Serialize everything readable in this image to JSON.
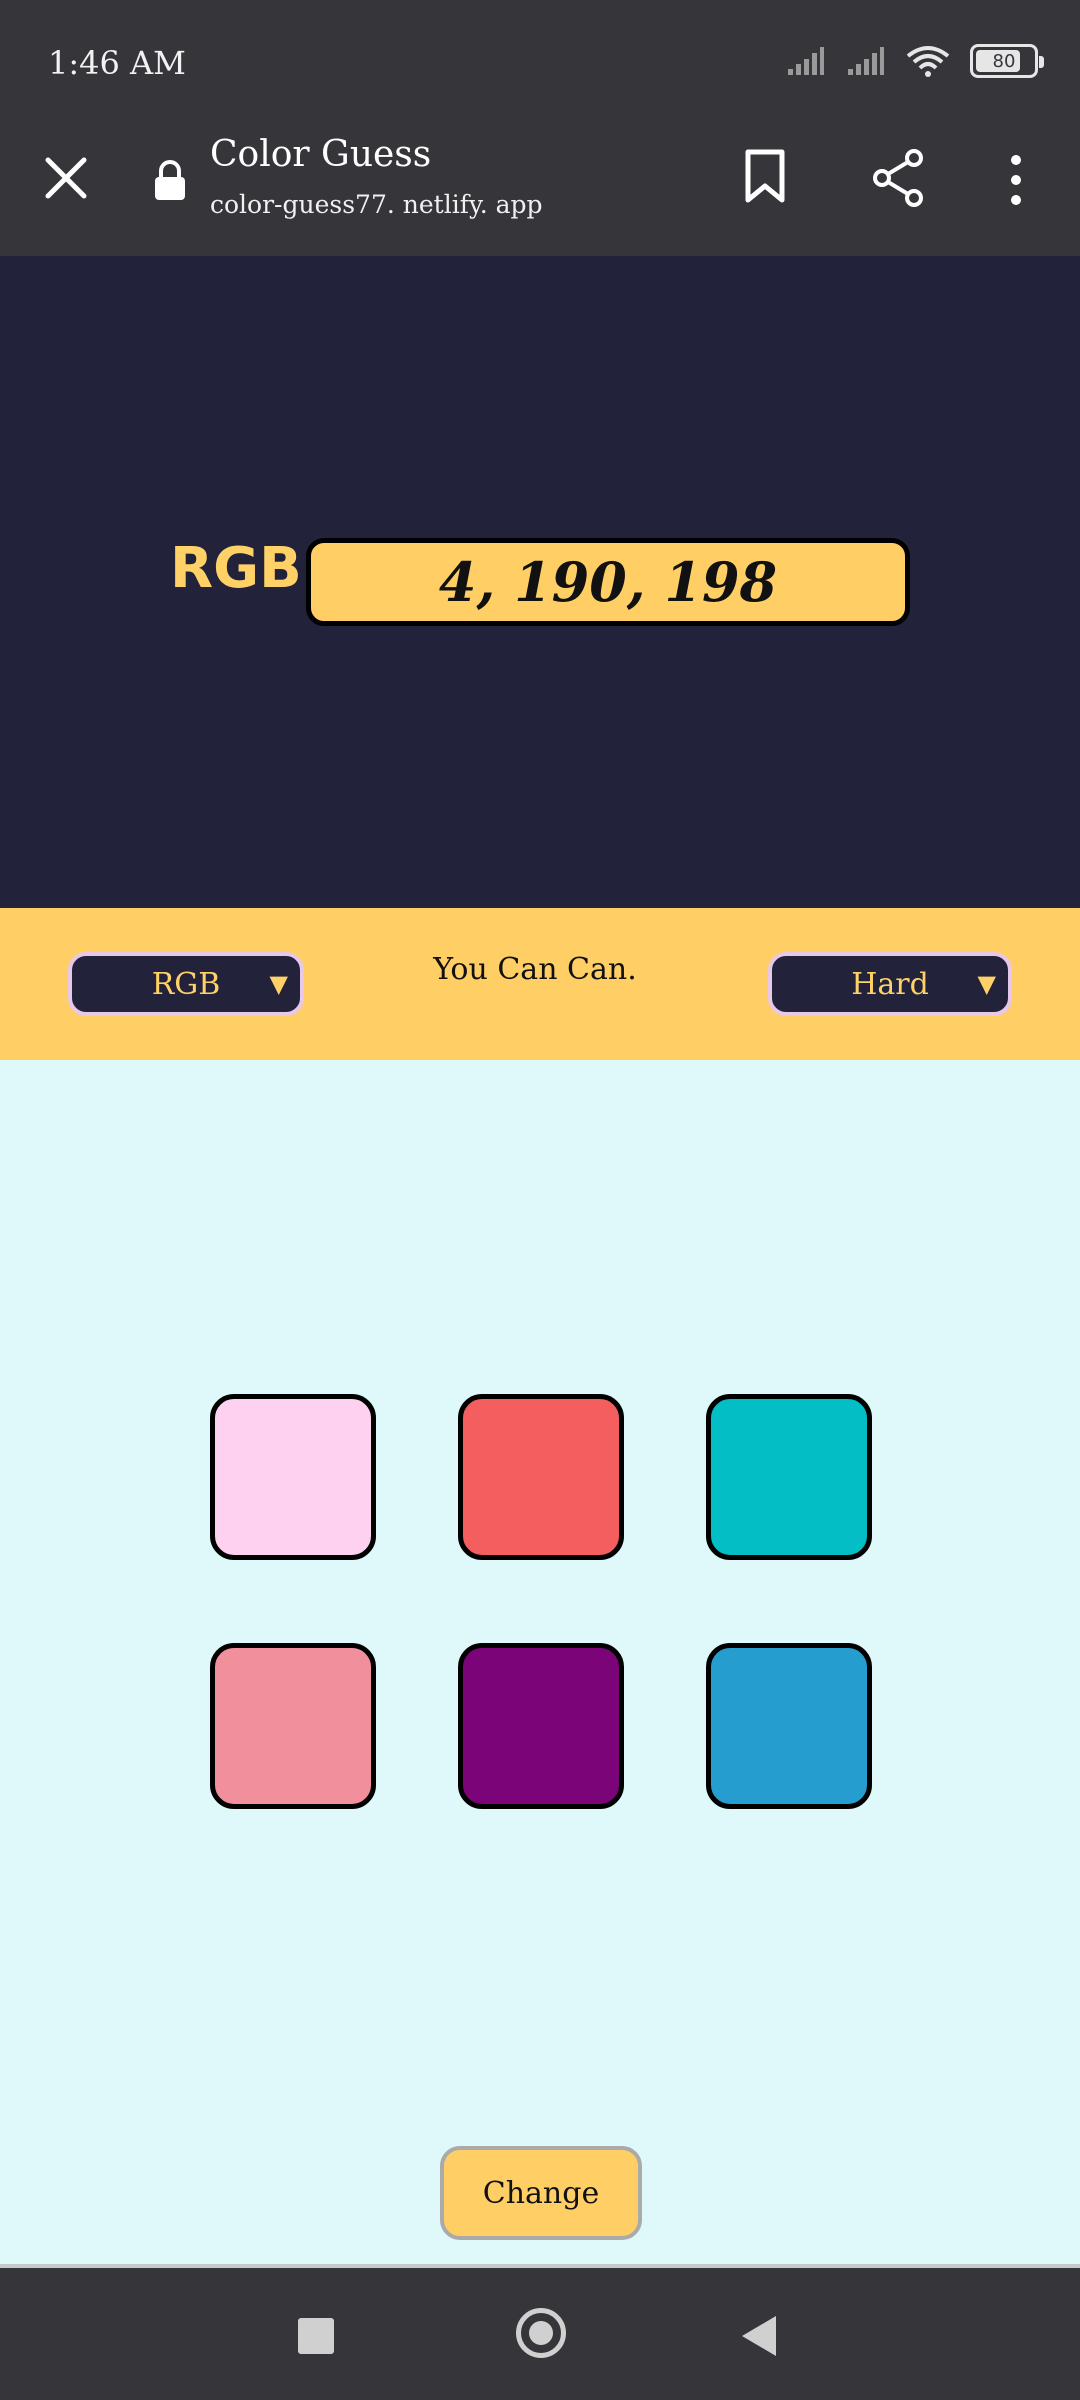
{
  "status_bar": {
    "time": "1:46 AM",
    "battery_text": "80",
    "battery_level": 0.8,
    "icons": [
      "signal-icon",
      "signal-icon",
      "wifi-icon",
      "battery-icon"
    ]
  },
  "browser": {
    "title": "Color Guess",
    "url": "color-guess77. netlify. app",
    "icons": [
      "close-icon",
      "lock-icon",
      "bookmark-icon",
      "share-icon",
      "more-icon"
    ]
  },
  "game": {
    "mode_label": "RGB",
    "target_value": "4, 190, 198",
    "mode_select": "RGB",
    "message": "You Can Can.",
    "difficulty_select": "Hard",
    "change_label": "Change",
    "swatches": [
      {
        "color": "#ffd1f1"
      },
      {
        "color": "#f45e5f"
      },
      {
        "color": "#04bec6"
      },
      {
        "color": "#f28f9c"
      },
      {
        "color": "#7b0478"
      },
      {
        "color": "#259ecf"
      }
    ]
  },
  "colors": {
    "header_bg": "#22223b",
    "accent_yellow": "#ffcf66",
    "page_bg": "#dff8f9",
    "chrome_bg": "#36363a"
  },
  "nav": {
    "icons": [
      "recents-icon",
      "home-icon",
      "back-icon"
    ]
  }
}
